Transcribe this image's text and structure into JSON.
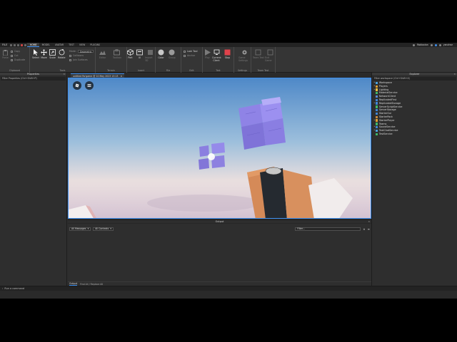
{
  "menubar": {
    "file_label": "FILE",
    "tabs": [
      {
        "label": "HOME",
        "active": true
      },
      {
        "label": "MODEL",
        "active": false
      },
      {
        "label": "AVATAR",
        "active": false
      },
      {
        "label": "TEST",
        "active": false
      },
      {
        "label": "VIEW",
        "active": false
      },
      {
        "label": "PLUGINS",
        "active": false
      }
    ],
    "user_name": "Robloxian",
    "account_name": "yanchez"
  },
  "ribbon": {
    "clipboard": {
      "label": "Clipboard",
      "paste": "Paste",
      "copy": "Copy",
      "cut": "Cut",
      "duplicate": "Duplicate"
    },
    "tools": {
      "label": "Tools",
      "select": "Select",
      "move": "Move",
      "scale": "Scale",
      "rotate": "Rotate",
      "mode_label": "Mode:",
      "mode_value": "Geometric",
      "collisions": "Collisions",
      "join_surfaces": "Join Surfaces"
    },
    "terrain": {
      "label": "Terrain",
      "editor": "Editor",
      "toolbox": "Toolbox"
    },
    "insert": {
      "label": "Insert",
      "part": "Part",
      "ui": "UI",
      "import3d": "Import 3D"
    },
    "file": {
      "label": "File",
      "material_manager": "Material",
      "color": "Color",
      "group": "Group"
    },
    "edit": {
      "label": "Edit",
      "lock": "Lock Tool",
      "anchor": "Anchor"
    },
    "test": {
      "label": "Test",
      "play": "Play",
      "current_client": "Current: Client",
      "stop": "Stop"
    },
    "settings": {
      "label": "Settings",
      "game_settings": "Game Settings"
    },
    "team_test": {
      "label": "Team Test",
      "team_test": "Team Test",
      "exit_game": "Exit Game"
    }
  },
  "properties": {
    "title": "Properties",
    "filter_placeholder": "Filter Properties (Ctrl+Shift+P)"
  },
  "document": {
    "tab_label": "untitled Ro'game @ 10 May 2023 13:13"
  },
  "explorer": {
    "title": "Explorer",
    "filter_placeholder": "Filter workspace (Ctrl+Shift+X)",
    "items": [
      {
        "label": "Workspace",
        "color": "#4aa3df",
        "arrow": "▸"
      },
      {
        "label": "Players",
        "color": "#e0a030",
        "arrow": "▸"
      },
      {
        "label": "Lighting",
        "color": "#f0c040",
        "arrow": "▸"
      },
      {
        "label": "MaterialService",
        "color": "#3fb96a",
        "arrow": ""
      },
      {
        "label": "NetworkClient",
        "color": "#5a8bd8",
        "arrow": ""
      },
      {
        "label": "ReplicatedFirst",
        "color": "#3f86d8",
        "arrow": ""
      },
      {
        "label": "ReplicatedStorage",
        "color": "#3f86d8",
        "arrow": "▸"
      },
      {
        "label": "ServerScriptService",
        "color": "#3fb96a",
        "arrow": ""
      },
      {
        "label": "ServerStorage",
        "color": "#3f86d8",
        "arrow": ""
      },
      {
        "label": "StarterGui",
        "color": "#3f86d8",
        "arrow": ""
      },
      {
        "label": "StarterPack",
        "color": "#c98a3c",
        "arrow": ""
      },
      {
        "label": "StarterPlayer",
        "color": "#e0a030",
        "arrow": "▸"
      },
      {
        "label": "Teams",
        "color": "#3fb96a",
        "arrow": ""
      },
      {
        "label": "SoundService",
        "color": "#3f86d8",
        "arrow": "▸"
      },
      {
        "label": "TextChatService",
        "color": "#4aa3df",
        "arrow": "▸"
      },
      {
        "label": "TestService",
        "color": "#3fb96a",
        "arrow": ""
      }
    ]
  },
  "output": {
    "title": "Output",
    "all_messages": "All Messages",
    "all_contexts": "All Contexts",
    "filter_placeholder": "Filter...",
    "foot_tabs": [
      "Output",
      "Find All / Replace All"
    ]
  },
  "command_bar": {
    "placeholder": "Run a command"
  },
  "colors": {
    "accent": "#3c8ff0",
    "panel_bg": "#2e2e2e",
    "ribbon_bg": "#353535",
    "stop_red": "#e0424b"
  }
}
